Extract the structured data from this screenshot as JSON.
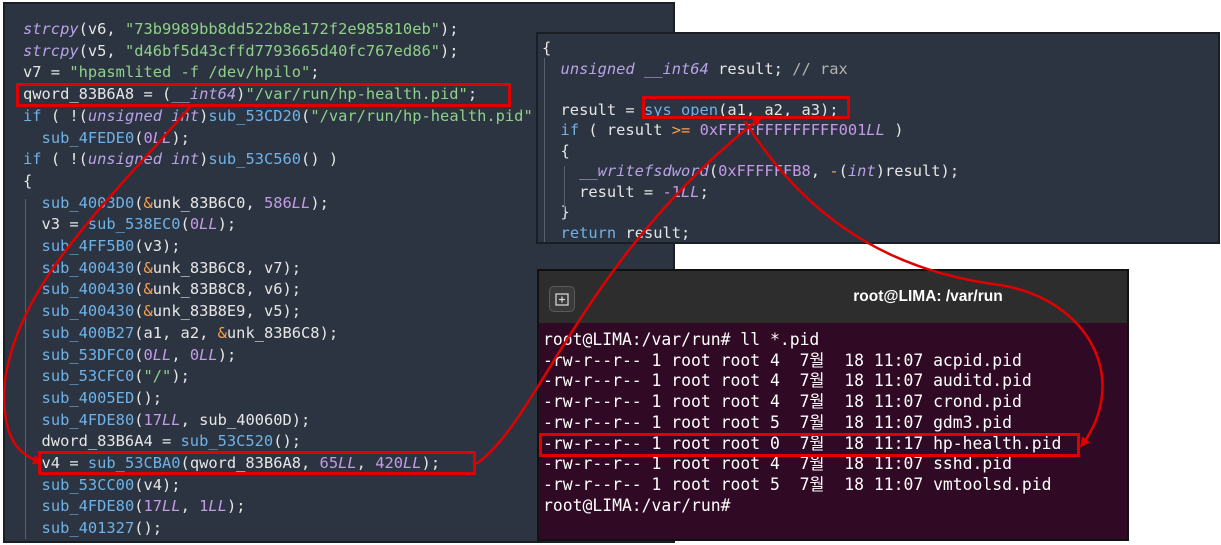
{
  "left_code": [
    [
      [
        "strcpy",
        "c-kw"
      ],
      [
        "(v6, ",
        "c-plain"
      ],
      [
        "\"73b9989bb8dd522b8e172f2e985810eb\"",
        "c-str"
      ],
      [
        ");",
        "c-plain"
      ]
    ],
    [
      [
        "strcpy",
        "c-kw"
      ],
      [
        "(v5, ",
        "c-plain"
      ],
      [
        "\"d46bf5d43cffd7793665d40fc767ed86\"",
        "c-str"
      ],
      [
        ");",
        "c-plain"
      ]
    ],
    [
      [
        "v7 = ",
        "c-plain"
      ],
      [
        "\"hpasmlited -f /dev/hpilo\"",
        "c-str"
      ],
      [
        ";",
        "c-plain"
      ]
    ],
    [
      [
        "qword_83B6A8",
        "c-plain"
      ],
      [
        " = (",
        "c-plain"
      ],
      [
        "__int64",
        "c-kw"
      ],
      [
        ")",
        "c-plain"
      ],
      [
        "\"/var/run/hp-health.pid\"",
        "c-str"
      ],
      [
        ";",
        "c-plain"
      ]
    ],
    [
      [
        "if",
        "c-fn"
      ],
      [
        " ( !(",
        "c-plain"
      ],
      [
        "unsigned int",
        "c-kw"
      ],
      [
        ")",
        "c-plain"
      ],
      [
        "sub_53CD20",
        "c-fn"
      ],
      [
        "(",
        "c-plain"
      ],
      [
        "\"/var/run/hp-health.pid\"",
        "c-str"
      ]
    ],
    [
      [
        "  ",
        "c-plain"
      ],
      [
        "sub_4FEDE0",
        "c-fn"
      ],
      [
        "(",
        "c-plain"
      ],
      [
        "0",
        "c-num"
      ],
      [
        "LL",
        "c-sfx"
      ],
      [
        ");",
        "c-plain"
      ]
    ],
    [
      [
        "if",
        "c-fn"
      ],
      [
        " ( !(",
        "c-plain"
      ],
      [
        "unsigned int",
        "c-kw"
      ],
      [
        ")",
        "c-plain"
      ],
      [
        "sub_53C560",
        "c-fn"
      ],
      [
        "() )",
        "c-plain"
      ]
    ],
    [
      [
        "{",
        "c-plain"
      ]
    ],
    [
      [
        "  ",
        "c-plain"
      ],
      [
        "sub_4003D0",
        "c-fn"
      ],
      [
        "(",
        "c-plain"
      ],
      [
        "&",
        "c-op"
      ],
      [
        "unk_83B6C0, ",
        "c-plain"
      ],
      [
        "586",
        "c-num"
      ],
      [
        "LL",
        "c-sfx"
      ],
      [
        ");",
        "c-plain"
      ]
    ],
    [
      [
        "  v3 = ",
        "c-plain"
      ],
      [
        "sub_538EC0",
        "c-fn"
      ],
      [
        "(",
        "c-plain"
      ],
      [
        "0",
        "c-num"
      ],
      [
        "LL",
        "c-sfx"
      ],
      [
        ");",
        "c-plain"
      ]
    ],
    [
      [
        "  ",
        "c-plain"
      ],
      [
        "sub_4FF5B0",
        "c-fn"
      ],
      [
        "(v3);",
        "c-plain"
      ]
    ],
    [
      [
        "  ",
        "c-plain"
      ],
      [
        "sub_400430",
        "c-fn"
      ],
      [
        "(",
        "c-plain"
      ],
      [
        "&",
        "c-op"
      ],
      [
        "unk_83B6C8, v7);",
        "c-plain"
      ]
    ],
    [
      [
        "  ",
        "c-plain"
      ],
      [
        "sub_400430",
        "c-fn"
      ],
      [
        "(",
        "c-plain"
      ],
      [
        "&",
        "c-op"
      ],
      [
        "unk_83B8C8, v6);",
        "c-plain"
      ]
    ],
    [
      [
        "  ",
        "c-plain"
      ],
      [
        "sub_400430",
        "c-fn"
      ],
      [
        "(",
        "c-plain"
      ],
      [
        "&",
        "c-op"
      ],
      [
        "unk_83B8E9, v5);",
        "c-plain"
      ]
    ],
    [
      [
        "  ",
        "c-plain"
      ],
      [
        "sub_400B27",
        "c-fn"
      ],
      [
        "(a1, a2, ",
        "c-plain"
      ],
      [
        "&",
        "c-op"
      ],
      [
        "unk_83B6C8);",
        "c-plain"
      ]
    ],
    [
      [
        "  ",
        "c-plain"
      ],
      [
        "sub_53DFC0",
        "c-fn"
      ],
      [
        "(",
        "c-plain"
      ],
      [
        "0",
        "c-num"
      ],
      [
        "LL",
        "c-sfx"
      ],
      [
        ", ",
        "c-plain"
      ],
      [
        "0",
        "c-num"
      ],
      [
        "LL",
        "c-sfx"
      ],
      [
        ");",
        "c-plain"
      ]
    ],
    [
      [
        "  ",
        "c-plain"
      ],
      [
        "sub_53CFC0",
        "c-fn"
      ],
      [
        "(",
        "c-plain"
      ],
      [
        "\"/\"",
        "c-str"
      ],
      [
        ");",
        "c-plain"
      ]
    ],
    [
      [
        "  ",
        "c-plain"
      ],
      [
        "sub_4005ED",
        "c-fn"
      ],
      [
        "();",
        "c-plain"
      ]
    ],
    [
      [
        "  ",
        "c-plain"
      ],
      [
        "sub_4FDE80",
        "c-fn"
      ],
      [
        "(",
        "c-plain"
      ],
      [
        "17",
        "c-num"
      ],
      [
        "LL",
        "c-sfx"
      ],
      [
        ", sub_40060D);",
        "c-plain"
      ]
    ],
    [
      [
        "  dword_83B6A4 = ",
        "c-plain"
      ],
      [
        "sub_53C520",
        "c-fn"
      ],
      [
        "();",
        "c-plain"
      ]
    ],
    [
      [
        "  v4 = ",
        "c-plain"
      ],
      [
        "sub_53CBA0",
        "c-fn"
      ],
      [
        "(qword_83B6A8, ",
        "c-plain"
      ],
      [
        "65",
        "c-num"
      ],
      [
        "LL",
        "c-sfx"
      ],
      [
        ", ",
        "c-plain"
      ],
      [
        "420",
        "c-num"
      ],
      [
        "LL",
        "c-sfx"
      ],
      [
        ");",
        "c-plain"
      ]
    ],
    [
      [
        "  ",
        "c-plain"
      ],
      [
        "sub_53CC00",
        "c-fn"
      ],
      [
        "(v4);",
        "c-plain"
      ]
    ],
    [
      [
        "  ",
        "c-plain"
      ],
      [
        "sub_4FDE80",
        "c-fn"
      ],
      [
        "(",
        "c-plain"
      ],
      [
        "17",
        "c-num"
      ],
      [
        "LL",
        "c-sfx"
      ],
      [
        ", ",
        "c-plain"
      ],
      [
        "1",
        "c-num"
      ],
      [
        "LL",
        "c-sfx"
      ],
      [
        ");",
        "c-plain"
      ]
    ],
    [
      [
        "  ",
        "c-plain"
      ],
      [
        "sub_401327",
        "c-fn"
      ],
      [
        "();",
        "c-plain"
      ]
    ]
  ],
  "right_code": [
    [
      [
        "{",
        "c-plain"
      ]
    ],
    [
      [
        "  ",
        "c-plain"
      ],
      [
        "unsigned __int64",
        "c-kw"
      ],
      [
        " result; ",
        "c-plain"
      ],
      [
        "// rax",
        "c-cmt"
      ]
    ],
    [
      [
        "",
        "c-plain"
      ]
    ],
    [
      [
        "  result = ",
        "c-plain"
      ],
      [
        "sys_open",
        "c-fn"
      ],
      [
        "(a1, a2, a3);",
        "c-plain"
      ]
    ],
    [
      [
        "  ",
        "c-plain"
      ],
      [
        "if",
        "c-fn"
      ],
      [
        " ( result ",
        "c-plain"
      ],
      [
        ">=",
        "c-op"
      ],
      [
        " ",
        "c-plain"
      ],
      [
        "0xFFFFFFFFFFFFF001",
        "c-num"
      ],
      [
        "LL",
        "c-sfx"
      ],
      [
        " )",
        "c-plain"
      ]
    ],
    [
      [
        "  {",
        "c-plain"
      ]
    ],
    [
      [
        "    ",
        "c-plain"
      ],
      [
        "__writefsdword",
        "c-kw"
      ],
      [
        "(",
        "c-plain"
      ],
      [
        "0xFFFFFFB8",
        "c-num"
      ],
      [
        ", ",
        "c-plain"
      ],
      [
        "-",
        "c-op"
      ],
      [
        "(",
        "c-plain"
      ],
      [
        "int",
        "c-kw"
      ],
      [
        ")result);",
        "c-plain"
      ]
    ],
    [
      [
        "    result = ",
        "c-plain"
      ],
      [
        "-1",
        "c-num"
      ],
      [
        "LL",
        "c-sfx"
      ],
      [
        ";",
        "c-plain"
      ]
    ],
    [
      [
        "  }",
        "c-plain"
      ]
    ],
    [
      [
        "  ",
        "c-plain"
      ],
      [
        "return",
        "c-fn"
      ],
      [
        " result;",
        "c-plain"
      ]
    ]
  ],
  "terminal": {
    "title": "root@LIMA: /var/run",
    "lines": [
      "root@LIMA:/var/run# ll *.pid",
      "-rw-r--r-- 1 root root 4  7월  18 11:07 acpid.pid",
      "-rw-r--r-- 1 root root 4  7월  18 11:07 auditd.pid",
      "-rw-r--r-- 1 root root 4  7월  18 11:07 crond.pid",
      "-rw-r--r-- 1 root root 5  7월  18 11:07 gdm3.pid",
      "-rw-r--r-- 1 root root 0  7월  18 11:17 hp-health.pid",
      "-rw-r--r-- 1 root root 4  7월  18 11:07 sshd.pid",
      "-rw-r--r-- 1 root root 5  7월  18 11:07 vmtoolsd.pid",
      "root@LIMA:/var/run#"
    ]
  },
  "colors": {
    "code_bg": "#2b3440",
    "terminal_bg": "#300a24",
    "highlight": "#e00000"
  }
}
